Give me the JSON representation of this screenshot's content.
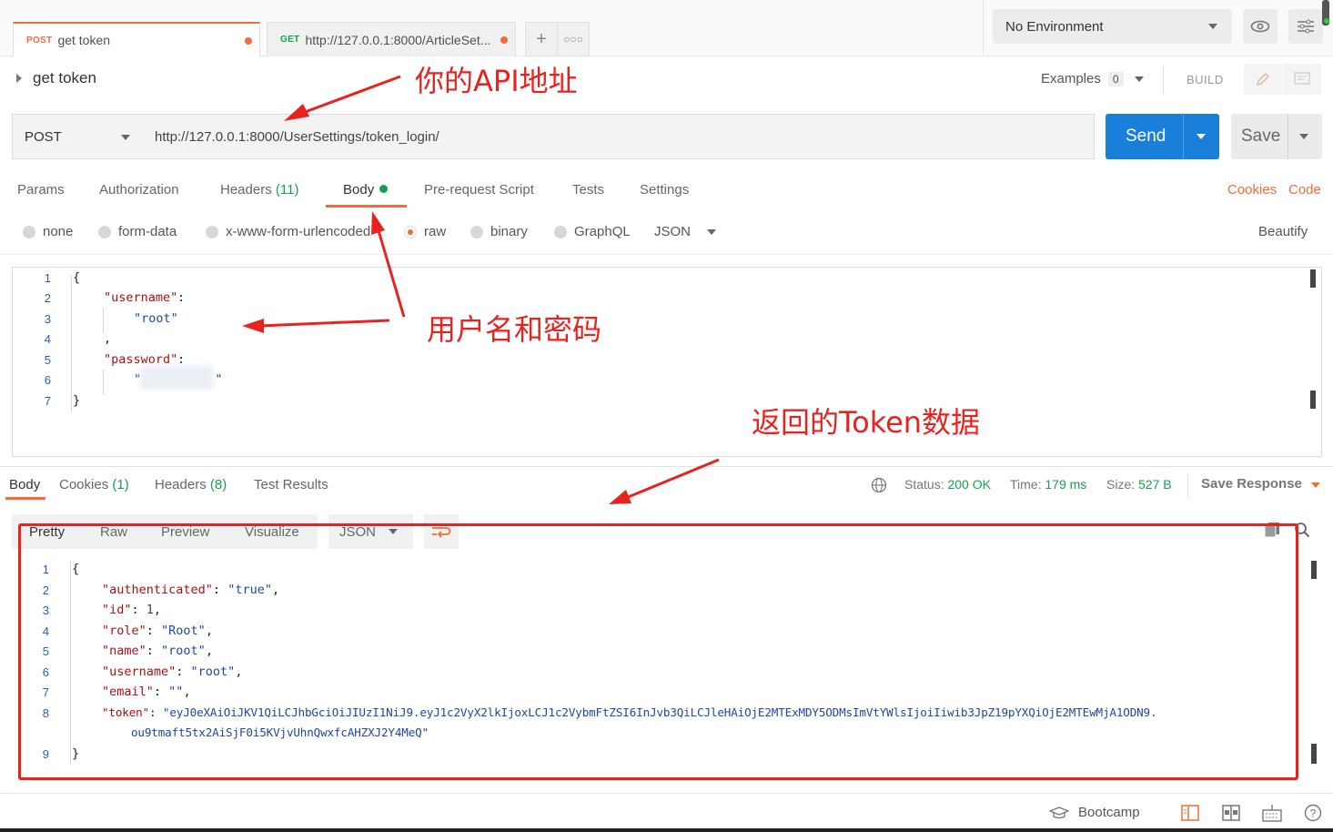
{
  "tabs": [
    {
      "method": "POST",
      "method_color": "#f26b3a",
      "label": "get token"
    },
    {
      "method": "GET",
      "method_color": "#14a04e",
      "label": "http://127.0.0.1:8000/ArticleSet..."
    }
  ],
  "environment": {
    "selected": "No Environment"
  },
  "request": {
    "name": "get token",
    "examples_label": "Examples",
    "examples_count": "0",
    "build_label": "BUILD",
    "method": "POST",
    "url": "http://127.0.0.1:8000/UserSettings/token_login/",
    "send_label": "Send",
    "save_label": "Save"
  },
  "request_tabs": {
    "params": "Params",
    "authorization": "Authorization",
    "headers": "Headers",
    "headers_count": "(11)",
    "body": "Body",
    "prerequest": "Pre-request Script",
    "tests": "Tests",
    "settings": "Settings",
    "cookies": "Cookies",
    "code": "Code"
  },
  "body_modes": {
    "none": "none",
    "form_data": "form-data",
    "urlencoded": "x-www-form-urlencoded",
    "raw": "raw",
    "binary": "binary",
    "graphql": "GraphQL",
    "format": "JSON",
    "beautify": "Beautify"
  },
  "request_body": {
    "line_numbers": [
      "1",
      "2",
      "3",
      "4",
      "5",
      "6",
      "7"
    ],
    "open_brace": "{",
    "key_username": "\"username\"",
    "colon": ":",
    "val_username": "\"root\"",
    "comma": ",",
    "key_password": "\"password\"",
    "val_password": "\"          \"",
    "close_brace": "}"
  },
  "response_tabs": {
    "body": "Body",
    "cookies": "Cookies",
    "cookies_count": "(1)",
    "headers": "Headers",
    "headers_count": "(8)",
    "test_results": "Test Results"
  },
  "response_status": {
    "status_label": "Status:",
    "status_value": "200 OK",
    "time_label": "Time:",
    "time_value": "179 ms",
    "size_label": "Size:",
    "size_value": "527 B",
    "save_response": "Save Response"
  },
  "response_view": {
    "pretty": "Pretty",
    "raw": "Raw",
    "preview": "Preview",
    "visualize": "Visualize",
    "format": "JSON"
  },
  "response_body": {
    "line_numbers": [
      "1",
      "2",
      "3",
      "4",
      "5",
      "6",
      "7",
      "8",
      "9"
    ],
    "line1": "{",
    "k_authenticated": "\"authenticated\"",
    "v_authenticated": "\"true\"",
    "k_id": "\"id\"",
    "v_id": "1",
    "k_role": "\"role\"",
    "v_role": "\"Root\"",
    "k_name": "\"name\"",
    "v_name": "\"root\"",
    "k_username": "\"username\"",
    "v_username": "\"root\"",
    "k_email": "\"email\"",
    "v_email": "\"\"",
    "k_token": "\"token\"",
    "v_token_1": "\"eyJ0eXAiOiJKV1QiLCJhbGciOiJIUzI1NiJ9.eyJ1c2VyX2lkIjoxLCJ1c2VybmFtZSI6InJvb3QiLCJleHAiOjE2MTExMDY5ODMsImVtYWlsIjoiIiwib3JpZ19pYXQiOjE2MTEwMjA1ODN9.",
    "v_token_2": "ou9tmaft5tx2AiSjF0i5KVjvUhnQwxfcAHZXJ2Y4MeQ\"",
    "line9": "}"
  },
  "annotations": {
    "api_address": "你的API地址",
    "credentials": "用户名和密码",
    "token_data": "返回的Token数据"
  },
  "footer": {
    "bootcamp": "Bootcamp"
  },
  "colors": {
    "accent": "#f26b3a",
    "send_blue": "#1a7fd9",
    "status_green": "#14a04e",
    "annotation_red": "#e8231f"
  }
}
